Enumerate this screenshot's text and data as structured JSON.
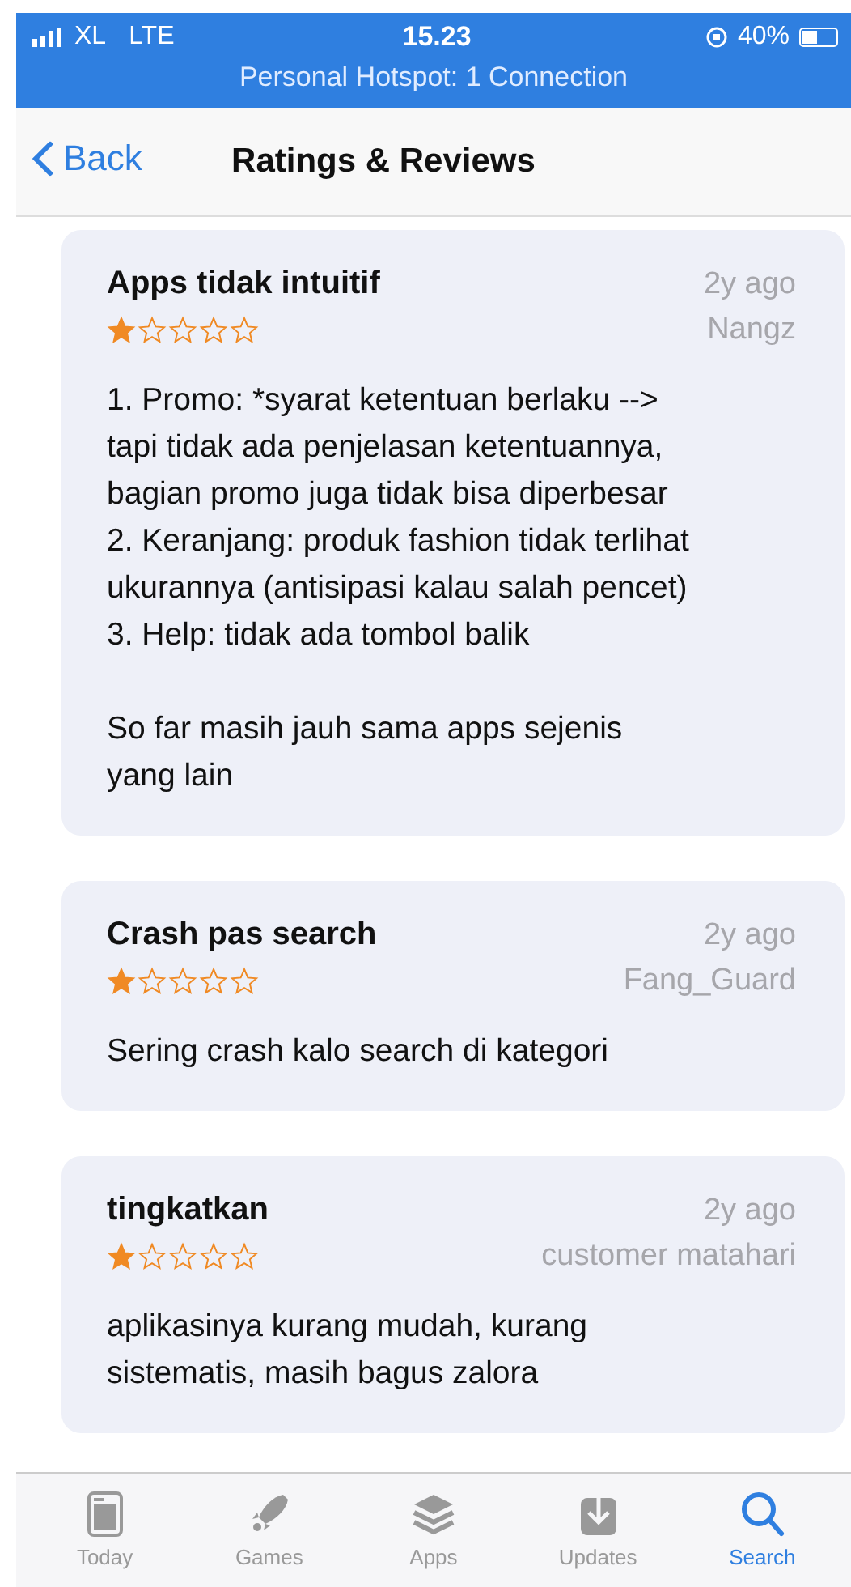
{
  "status_bar": {
    "carrier": "XL",
    "network": "LTE",
    "time": "15.23",
    "battery": "40%",
    "hotspot": "Personal Hotspot: 1 Connection"
  },
  "nav": {
    "back": "Back",
    "title": "Ratings & Reviews"
  },
  "reviews": [
    {
      "title": "Apps tidak intuitif",
      "age": "2y ago",
      "stars": 1,
      "author": "Nangz",
      "body": "1. Promo: *syarat ketentuan berlaku -->\ntapi tidak ada penjelasan ketentuannya,\nbagian promo juga tidak bisa diperbesar\n2. Keranjang: produk fashion tidak terlihat\nukurannya (antisipasi kalau salah pencet)\n3. Help: tidak ada tombol balik\n\nSo far masih jauh sama apps sejenis\nyang lain"
    },
    {
      "title": "Crash pas search",
      "age": "2y ago",
      "stars": 1,
      "author": "Fang_Guard",
      "body": "Sering crash kalo search di kategori"
    },
    {
      "title": "tingkatkan",
      "age": "2y ago",
      "stars": 1,
      "author": "customer matahari",
      "body": "aplikasinya kurang mudah, kurang\nsistematis, masih bagus zalora"
    }
  ],
  "tab_bar": [
    {
      "kind": "today",
      "label": "Today",
      "selected": false
    },
    {
      "kind": "games",
      "label": "Games",
      "selected": false
    },
    {
      "kind": "apps",
      "label": "Apps",
      "selected": false
    },
    {
      "kind": "updates",
      "label": "Updates",
      "selected": false
    },
    {
      "kind": "search",
      "label": "Search",
      "selected": true
    }
  ]
}
